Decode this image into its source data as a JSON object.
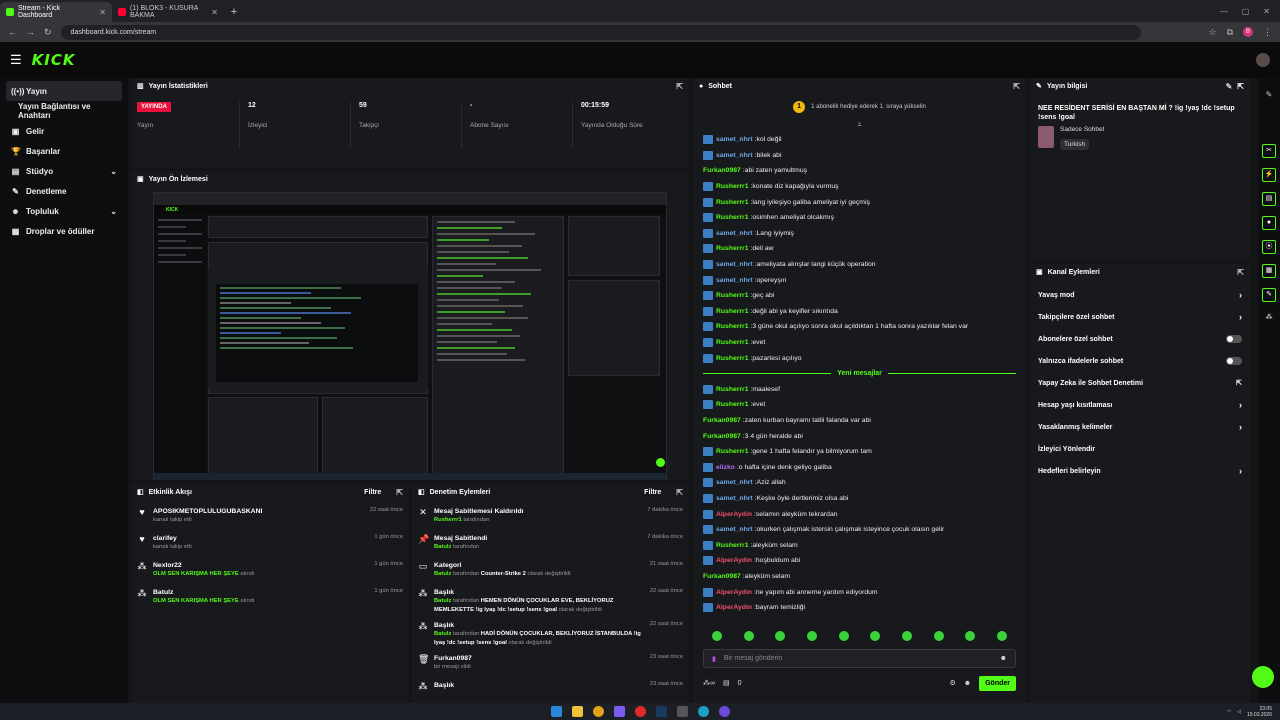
{
  "browser": {
    "tabs": [
      {
        "title": "Stream - Kick Dashboard",
        "favicon_color": "#53fc18",
        "active": true
      },
      {
        "title": "(1) BLOK3 - KUSURA BAKMA",
        "favicon_color": "#ff0033",
        "active": false
      }
    ],
    "url": "dashboard.kick.com/stream"
  },
  "nav": {
    "logo": "KICK"
  },
  "sidebar": {
    "items": [
      {
        "label": "Yayın",
        "icon": "broadcast-icon",
        "glyph": "((•))",
        "active": true
      },
      {
        "label": "Yayın Bağlantısı ve Anahtarı",
        "sub": true
      },
      {
        "label": "Gelir",
        "icon": "money-icon",
        "glyph": "▣"
      },
      {
        "label": "Başarılar",
        "icon": "trophy-icon",
        "glyph": "🏆"
      },
      {
        "label": "Stüdyo",
        "icon": "studio-icon",
        "glyph": "▤",
        "chevron": true
      },
      {
        "label": "Denetleme",
        "icon": "wrench-icon",
        "glyph": "✎"
      },
      {
        "label": "Topluluk",
        "icon": "community-icon",
        "glyph": "☻",
        "chevron": true
      },
      {
        "label": "Droplar ve ödüller",
        "icon": "gift-icon",
        "glyph": "▦"
      }
    ]
  },
  "stats": {
    "title": "Yayın İstatistikleri",
    "items": [
      {
        "badge": "YAYINDA",
        "label": "Yayın"
      },
      {
        "value": "12",
        "label": "İzleyici"
      },
      {
        "value": "59",
        "label": "Takipçi"
      },
      {
        "value": "-",
        "label": "Abone Sayısı"
      },
      {
        "value": "00:15:59",
        "label": "Yayında Olduğu Süre"
      }
    ]
  },
  "preview": {
    "title": "Yayın Ön İzlemesi"
  },
  "activity": {
    "title": "Etkinlik Akışı",
    "filter": "Filtre",
    "items": [
      {
        "icon": "heart-icon",
        "glyph": "♥",
        "title": "APOSIKMETOPLULUGUBASKANI",
        "sub": "kanalı takip etti",
        "time": "22 saat önce"
      },
      {
        "icon": "heart-icon",
        "glyph": "♥",
        "title": "clarifey",
        "sub": "kanalı takip etti",
        "time": "1 gün önce"
      },
      {
        "icon": "reward-icon",
        "glyph": "⁂",
        "title": "Nexlor22",
        "highlight": "OLM SEN KARIŞMA HER ŞEYE",
        "sub": "alındı",
        "time": "1 gün önce"
      },
      {
        "icon": "reward-icon",
        "glyph": "⁂",
        "title": "Batulz",
        "highlight": "OLM SEN KARIŞMA HER ŞEYE",
        "sub": "alındı",
        "time": "1 gün önce"
      }
    ]
  },
  "moderation": {
    "title": "Denetim Eylemleri",
    "filter": "Filtre",
    "items": [
      {
        "icon": "unpin-icon",
        "glyph": "✕",
        "title": "Mesaj Sabitlemesi Kaldırıldı",
        "actor": "Rusherrr1",
        "sub": "tarafından",
        "time": "7 dakika önce"
      },
      {
        "icon": "pin-icon",
        "glyph": "📌",
        "title": "Mesaj Sabitlendi",
        "actor": "Batulz",
        "sub": "tarafından",
        "time": "7 dakika önce"
      },
      {
        "icon": "category-icon",
        "glyph": "▭",
        "title": "Kategori",
        "actor": "Batulz",
        "sub": "tarafından",
        "extra": "Counter-Strike 2",
        "sub2": "olarak değiştirildi",
        "time": "21 saat önce"
      },
      {
        "icon": "title-icon",
        "glyph": "⁂",
        "title": "Başlık",
        "actor": "Batulz",
        "sub": "tarafından",
        "extra": "HEMEN DÖNÜN ÇOCUKLAR EVE, BEKLİYORUZ MEMLEKETTE !ig Iyaş !dc !setup !sens !goal",
        "sub2": "olarak değiştirildi",
        "time": "22 saat önce"
      },
      {
        "icon": "title-icon",
        "glyph": "⁂",
        "title": "Başlık",
        "actor": "Batulz",
        "sub": "tarafından",
        "extra": "HADİ DÖNÜN ÇOCUKLAR, BEKLİYORUZ İSTANBULDA !ig Iyaş !dc !setup !sens !goal",
        "sub2": "olarak değiştirildi",
        "time": "22 saat önce"
      },
      {
        "icon": "trash-icon",
        "glyph": "🗑",
        "title": "Furkan0987",
        "sub": "bir mesajı sildi",
        "time": "23 saat önce"
      },
      {
        "icon": "title-icon",
        "glyph": "⁂",
        "title": "Başlık",
        "time": "23 saat önce"
      }
    ]
  },
  "chat": {
    "title": "Sohbet",
    "banner": "1 abonelik hediye ederek 1. sıraya yükselin",
    "banner_badge": "1",
    "new_messages": "Yeni mesajlar",
    "messages": [
      {
        "user": "samet_nhrt",
        "color": "#6fa8e6",
        "text": "kol değil",
        "badge": true
      },
      {
        "user": "samet_nhrt",
        "color": "#6fa8e6",
        "text": "bilek abi",
        "badge": true
      },
      {
        "user": "Furkan0987",
        "color": "#53fc18",
        "text": "abi zaten yamultmuş"
      },
      {
        "user": "Rusherrr1",
        "color": "#53fc18",
        "text": "konate diz kapağıyla vurmuş",
        "badge": true
      },
      {
        "user": "Rusherrr1",
        "color": "#53fc18",
        "text": "lang iyileşiyo galiba ameliyat iyi geçmiş",
        "badge": true
      },
      {
        "user": "Rusherrr1",
        "color": "#53fc18",
        "text": "osimhen ameliyat olcakmış",
        "badge": true
      },
      {
        "user": "samet_nhrt",
        "color": "#6fa8e6",
        "text": "Lang iyiymiş",
        "badge": true
      },
      {
        "user": "Rusherrr1",
        "color": "#53fc18",
        "text": "deli aw",
        "badge": true
      },
      {
        "user": "samet_nhrt",
        "color": "#6fa8e6",
        "text": "ameliyata alınşlar langi küçük operation",
        "badge": true
      },
      {
        "user": "samet_nhrt",
        "color": "#6fa8e6",
        "text": "opereyşın",
        "badge": true
      },
      {
        "user": "Rusherrr1",
        "color": "#53fc18",
        "text": "geç abi",
        "badge": true
      },
      {
        "user": "Rusherrr1",
        "color": "#53fc18",
        "text": "değil abi ya keyifler sıkıntıda",
        "badge": true
      },
      {
        "user": "Rusherrr1",
        "color": "#53fc18",
        "text": "3 güne okul açılıyo sonra okul açıldıktan 1 hafta sonra yazılılar felan var",
        "badge": true
      },
      {
        "user": "Rusherrr1",
        "color": "#53fc18",
        "text": "evet",
        "badge": true
      },
      {
        "user": "Rusherrr1",
        "color": "#53fc18",
        "text": "pazartesi açılıyo",
        "badge": true
      },
      {
        "separator": true
      },
      {
        "user": "Rusherrr1",
        "color": "#53fc18",
        "text": "maalesef",
        "badge": true
      },
      {
        "user": "Rusherrr1",
        "color": "#53fc18",
        "text": "evet",
        "badge": true
      },
      {
        "user": "Furkan0987",
        "color": "#53fc18",
        "text": "zaten kurban bayramı tatili falanda var abi"
      },
      {
        "user": "Furkan0987",
        "color": "#53fc18",
        "text": "3 4 gün heralde abi"
      },
      {
        "user": "Rusherrr1",
        "color": "#53fc18",
        "text": "gene 1 hafta felandır ya bilmiyorum tam",
        "badge": true
      },
      {
        "user": "elizko",
        "color": "#b86cf0",
        "text": "o hafta içine denk geliyo galiba",
        "badge": true
      },
      {
        "user": "samet_nhrt",
        "color": "#6fa8e6",
        "text": "Aziz allah",
        "badge": true
      },
      {
        "user": "samet_nhrt",
        "color": "#6fa8e6",
        "text": "Keşke öyle dertlerimiz olsa abi",
        "badge": true
      },
      {
        "user": "AlperAydin",
        "color": "#f0506e",
        "text": "selamın aleyküm tekrardan",
        "badge": true
      },
      {
        "user": "samet_nhrt",
        "color": "#6fa8e6",
        "text": "okurken çalışmak istersin çalışmak isteyince çocuk olasın gelir",
        "badge": true
      },
      {
        "user": "Rusherrr1",
        "color": "#53fc18",
        "text": "aleyküm selam",
        "badge": true
      },
      {
        "user": "AlperAydin",
        "color": "#f0506e",
        "text": "hoşbuldum abi",
        "badge": true
      },
      {
        "user": "Furkan0987",
        "color": "#53fc18",
        "text": "aleyküm selam"
      },
      {
        "user": "AlperAydin",
        "color": "#f0506e",
        "text": "ne yapım abi anneme yardım ediyordum",
        "badge": true
      },
      {
        "user": "AlperAydin",
        "color": "#f0506e",
        "text": "bayram temizliği",
        "badge": true
      }
    ],
    "input_placeholder": "Bir mesaj gönderin",
    "points": "0",
    "send_label": "Gönder"
  },
  "stream_info": {
    "title_label": "Yayın bilgisi",
    "stream_title": "NEE RESİDENT SERİSİ EN BAŞTAN Mİ ? !ig !yaş !dc !setup !sens !goal",
    "mode": "Sadece Sohbet",
    "language": "Turkish"
  },
  "channel_actions": {
    "title": "Kanal Eylemleri",
    "items": [
      {
        "label": "Yavaş mod",
        "type": "chevron"
      },
      {
        "label": "Takipçilere özel sohbet",
        "type": "chevron"
      },
      {
        "label": "Abonelere özel sohbet",
        "type": "toggle"
      },
      {
        "label": "Yalnızca ifadelerle sohbet",
        "type": "toggle"
      },
      {
        "label": "Yapay Zeka ile Sohbet Denetimi",
        "type": "external"
      },
      {
        "label": "Hesap yaşı kısıtlaması",
        "type": "chevron"
      },
      {
        "label": "Yasaklanmış kelimeler",
        "type": "chevron"
      },
      {
        "label": "İzleyici Yönlendir",
        "type": "none"
      },
      {
        "label": "Hedefleri belirleyin",
        "type": "chevron"
      }
    ]
  },
  "taskbar": {
    "time": "23:05",
    "date": "19.03.2026"
  }
}
